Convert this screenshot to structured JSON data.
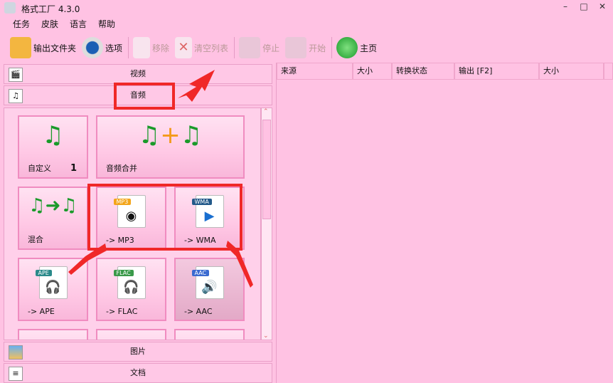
{
  "window": {
    "title": "格式工厂 4.3.0",
    "minimize": "–",
    "maximize": "□",
    "close": "✕"
  },
  "menu": [
    "任务",
    "皮肤",
    "语言",
    "帮助"
  ],
  "toolbar": [
    {
      "label": "输出文件夹",
      "icon": "folder-icon",
      "enabled": true
    },
    {
      "label": "选项",
      "icon": "gear-icon",
      "enabled": true
    },
    {
      "label": "移除",
      "icon": "remove-icon",
      "enabled": false
    },
    {
      "label": "清空列表",
      "icon": "clear-list-icon",
      "enabled": false
    },
    {
      "label": "停止",
      "icon": "stop-icon",
      "enabled": false
    },
    {
      "label": "开始",
      "icon": "start-icon",
      "enabled": false
    },
    {
      "label": "主页",
      "icon": "globe-icon",
      "enabled": true
    }
  ],
  "categories": {
    "video": "视频",
    "audio": "音频",
    "picture": "图片",
    "document": "文档"
  },
  "tiles": [
    {
      "label": "自定义",
      "badge": "1"
    },
    {
      "label": "音频合并"
    },
    {
      "label": "混合"
    },
    {
      "label": "-> MP3",
      "tag": "MP3"
    },
    {
      "label": "-> WMA",
      "tag": "WMA"
    },
    {
      "label": "-> APE",
      "tag": "APE"
    },
    {
      "label": "-> FLAC",
      "tag": "FLAC"
    },
    {
      "label": "-> AAC",
      "tag": "AAC"
    }
  ],
  "columns": [
    "来源",
    "大小",
    "转换状态",
    "输出 [F2]",
    "大小"
  ],
  "colors": {
    "annotation": "#f02828",
    "background": "#ffc2e3"
  }
}
